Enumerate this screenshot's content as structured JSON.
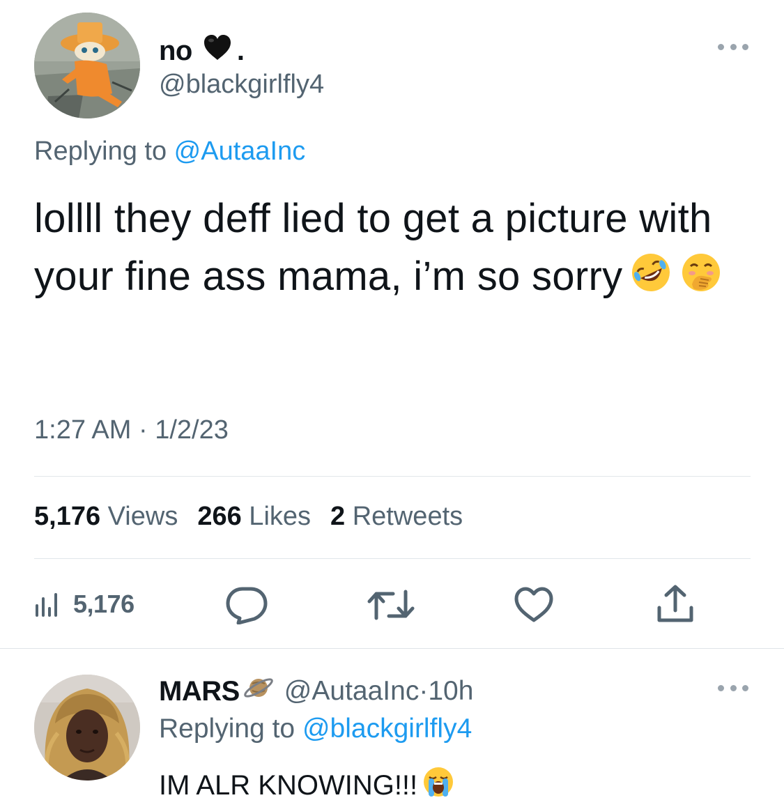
{
  "main_tweet": {
    "display_name": "no",
    "name_suffix": ".",
    "handle": "@blackgirlfly4",
    "replying_prefix": "Replying to ",
    "replying_to": "@AutaaInc",
    "text": "lollll they deff lied to get a picture with your fine ass mama, i’m so sorry",
    "emojis": [
      "rolling-on-floor-laughing-emoji",
      "hand-over-mouth-emoji"
    ],
    "time": "1:27 AM",
    "separator": " · ",
    "date": "1/2/23",
    "stats": {
      "views_count": "5,176",
      "views_label": " Views",
      "likes_count": "266",
      "likes_label": " Likes",
      "retweets_count": "2",
      "retweets_label": " Retweets"
    },
    "actions": {
      "views_count": "5,176",
      "icons": [
        "views-icon",
        "reply-icon",
        "retweet-icon",
        "like-icon",
        "share-icon"
      ]
    }
  },
  "reply_tweet": {
    "display_name": "MARS",
    "handle": "@AutaaInc",
    "separator": " · ",
    "time_ago": "10h",
    "replying_prefix": "Replying to ",
    "replying_to": "@blackgirlfly4",
    "text": "IM ALR KNOWING!!!",
    "emojis": [
      "loudly-crying-emoji"
    ]
  },
  "colors": {
    "text": "#0f1419",
    "secondary": "#536471",
    "link": "#1d9bf0",
    "divider": "#e1e6ea"
  }
}
